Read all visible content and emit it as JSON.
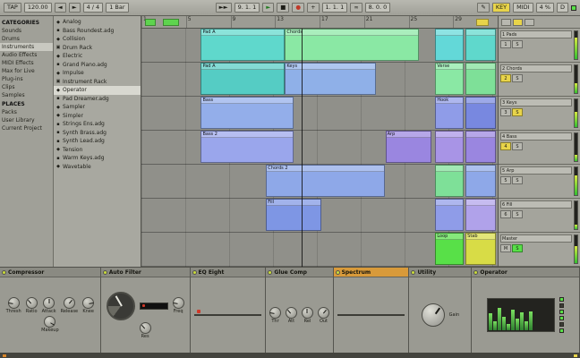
{
  "colors": {
    "accent_yellow": "#e8d44a",
    "accent_green": "#58e048",
    "record_red": "#c03828",
    "meter_green": "#30c030"
  },
  "transport": {
    "tap": "TAP",
    "tempo": "120.00",
    "nudge_down": "◄",
    "nudge_up": "►",
    "signature": "4 / 4",
    "quantize": "1 Bar",
    "follow": "►►",
    "position": "9. 1. 1",
    "play": "►",
    "stop": "■",
    "record": "●",
    "overdub": "+",
    "loop_start": "1. 1. 1",
    "loop": "∞",
    "loop_length": "8. 0. 0",
    "pencil": "✎",
    "key": "KEY",
    "midi": "MIDI",
    "cpu": "4 %",
    "disk": "D"
  },
  "browser": {
    "selected_category": "Instruments",
    "sections": [
      {
        "title": "CATEGORIES",
        "items": [
          "Sounds",
          "Drums",
          "Instruments",
          "Audio Effects",
          "MIDI Effects",
          "Max for Live",
          "Plug-ins",
          "Clips",
          "Samples"
        ]
      },
      {
        "title": "PLACES",
        "items": [
          "Packs",
          "User Library",
          "Current Project"
        ]
      }
    ],
    "selected_index": 8,
    "items": [
      {
        "icon": "◆",
        "label": "Analog"
      },
      {
        "icon": "▪",
        "label": "Bass Roundest.adg"
      },
      {
        "icon": "◆",
        "label": "Collision"
      },
      {
        "icon": "▣",
        "label": "Drum Rack"
      },
      {
        "icon": "◆",
        "label": "Electric"
      },
      {
        "icon": "▪",
        "label": "Grand Piano.adg"
      },
      {
        "icon": "◆",
        "label": "Impulse"
      },
      {
        "icon": "▣",
        "label": "Instrument Rack"
      },
      {
        "icon": "◆",
        "label": "Operator"
      },
      {
        "icon": "▪",
        "label": "Pad Dreamer.adg"
      },
      {
        "icon": "◆",
        "label": "Sampler"
      },
      {
        "icon": "◆",
        "label": "Simpler"
      },
      {
        "icon": "▪",
        "label": "Strings Ens.adg"
      },
      {
        "icon": "▪",
        "label": "Synth Brass.adg"
      },
      {
        "icon": "▪",
        "label": "Synth Lead.adg"
      },
      {
        "icon": "◆",
        "label": "Tension"
      },
      {
        "icon": "▪",
        "label": "Warm Keys.adg"
      },
      {
        "icon": "◆",
        "label": "Wavetable"
      }
    ]
  },
  "arrangement": {
    "ruler": {
      "numbers": [
        "1",
        "5",
        "9",
        "13",
        "17",
        "21",
        "25",
        "29"
      ],
      "markers": [
        {
          "left": "1%",
          "width": "3%",
          "color": "#5ed44e"
        },
        {
          "left": "6%",
          "width": "4.5%",
          "color": "#5ed44e"
        },
        {
          "left": "94%",
          "width": "3.5%",
          "color": "#e8d44a"
        }
      ]
    },
    "tracks": [
      {
        "clips": [
          {
            "label": "Pad A",
            "left": "16.7%",
            "width": "23.5%",
            "color": "#5fd8cc"
          },
          {
            "label": "Chords",
            "left": "40.3%",
            "width": "37.5%",
            "color": "#8ae8a4"
          },
          {
            "label": "",
            "left": "82.5%",
            "width": "8%",
            "color": "#63d8d8"
          },
          {
            "label": "",
            "left": "91%",
            "width": "8.5%",
            "color": "#5fd8cc"
          }
        ]
      },
      {
        "clips": [
          {
            "label": "Pad A",
            "left": "16.7%",
            "width": "23.5%",
            "color": "#55ccc4"
          },
          {
            "label": "Keys",
            "left": "40.3%",
            "width": "25.6%",
            "color": "#8fb0e8"
          },
          {
            "label": "Verse",
            "left": "82.5%",
            "width": "8%",
            "color": "#8ae8a4"
          },
          {
            "label": "",
            "left": "91%",
            "width": "8.5%",
            "color": "#7ee098"
          }
        ]
      },
      {
        "clips": [
          {
            "label": "Bass",
            "left": "16.7%",
            "width": "26%",
            "color": "#93aeea"
          },
          {
            "label": "Hook",
            "left": "82.5%",
            "width": "8%",
            "color": "#8f9ce8"
          },
          {
            "label": "",
            "left": "91%",
            "width": "8.5%",
            "color": "#7888e0"
          }
        ]
      },
      {
        "clips": [
          {
            "label": "Bass 2",
            "left": "16.7%",
            "width": "26%",
            "color": "#9aa6ec"
          },
          {
            "label": "Arp",
            "left": "68.5%",
            "width": "12.8%",
            "color": "#9a86e0"
          },
          {
            "label": "",
            "left": "82.5%",
            "width": "8%",
            "color": "#a894e6"
          },
          {
            "label": "",
            "left": "91%",
            "width": "8.5%",
            "color": "#9a86e0"
          }
        ]
      },
      {
        "clips": [
          {
            "label": "Chords 2",
            "left": "35%",
            "width": "33.3%",
            "color": "#8ea8e8"
          },
          {
            "label": "",
            "left": "82.5%",
            "width": "8%",
            "color": "#7ee098"
          },
          {
            "label": "",
            "left": "91%",
            "width": "8.5%",
            "color": "#8ea8e8"
          }
        ]
      },
      {
        "clips": [
          {
            "label": "Fill",
            "left": "35%",
            "width": "15.4%",
            "color": "#7e96e4"
          },
          {
            "label": "",
            "left": "82.5%",
            "width": "8%",
            "color": "#8f9ce8"
          },
          {
            "label": "",
            "left": "91%",
            "width": "8.5%",
            "color": "#b0a2ea"
          }
        ]
      },
      {
        "clips": [
          {
            "label": "Loop",
            "left": "82.5%",
            "width": "8%",
            "color": "#58e048"
          },
          {
            "label": "Stab",
            "left": "91%",
            "width": "8.5%",
            "color": "#d8dc46"
          }
        ]
      }
    ]
  },
  "mixer": {
    "header_colors": [
      "#b8b8b0",
      "#e8d44a",
      "#b8b8b0"
    ],
    "strips": [
      {
        "label": "1 Pads",
        "slots": [
          "1",
          "S"
        ],
        "slot_colors": [
          "#b8b8b0",
          "#b8b8b0"
        ],
        "meter": 78
      },
      {
        "label": "2 Chords",
        "slots": [
          "2",
          "S"
        ],
        "slot_colors": [
          "#e8d44a",
          "#b8b8b0"
        ],
        "meter": 34
      },
      {
        "label": "3 Keys",
        "slots": [
          "3",
          "S"
        ],
        "slot_colors": [
          "#b8b8b0",
          "#e8d44a"
        ],
        "meter": 55
      },
      {
        "label": "4 Bass",
        "slots": [
          "4",
          "S"
        ],
        "slot_colors": [
          "#e8d44a",
          "#b8b8b0"
        ],
        "meter": 22
      },
      {
        "label": "5 Arp",
        "slots": [
          "5",
          "S"
        ],
        "slot_colors": [
          "#b8b8b0",
          "#b8b8b0"
        ],
        "meter": 70
      },
      {
        "label": "6 Fill",
        "slots": [
          "6",
          "S"
        ],
        "slot_colors": [
          "#b8b8b0",
          "#b8b8b0"
        ],
        "meter": 15
      },
      {
        "label": "Master",
        "slots": [
          "M",
          "S"
        ],
        "slot_colors": [
          "#b8b8b0",
          "#58e048"
        ],
        "meter": 62
      }
    ]
  },
  "devices": {
    "panels": [
      {
        "name": "Compressor",
        "type": "knobs",
        "w": 17.4,
        "title_bg": "#8a8a82",
        "knobs": [
          "Thresh",
          "Ratio",
          "Attack",
          "Release",
          "Knee",
          "Makeup"
        ]
      },
      {
        "name": "Auto Filter",
        "type": "gauge",
        "w": 15.4,
        "title_bg": "#8a8a82",
        "knobs": [
          "Freq",
          "Res"
        ]
      },
      {
        "name": "EQ Eight",
        "type": "display",
        "w": 13.1,
        "title_bg": "#8a8a82",
        "curve": "0,28 10,25 20,18 30,12 38,17 48,21 58,14 68,17 78,10 88,15 100,22",
        "curve_color": "#8fd2ff"
      },
      {
        "name": "Glue Comp",
        "type": "knobs",
        "w": 11.6,
        "title_bg": "#8a8a82",
        "knobs": [
          "Thr",
          "Att",
          "Rel",
          "Out"
        ]
      },
      {
        "name": "Spectrum",
        "type": "spectrum",
        "w": 13.1,
        "title_bg": "#d89a3a",
        "curve": "0,30 8,20 16,25 24,12 32,19 40,8 48,17 56,13 64,21 72,17 80,25 90,23 100,30",
        "curve2": "0,24 20,22 40,18 60,20 80,24 100,26",
        "curve_color": "#52e052",
        "curve2_color": "#e8e8e0"
      },
      {
        "name": "Utility",
        "type": "dial",
        "w": 10.8,
        "title_bg": "#8a8a82",
        "dial_label": "Gain"
      },
      {
        "name": "Operator",
        "type": "bars",
        "w": 18.6,
        "title_bg": "#8a8a82",
        "bars": [
          55,
          30,
          75,
          45,
          22,
          68,
          38,
          58,
          28,
          62
        ],
        "leds": [
          "#58e048",
          "#3a3a34",
          "#58e048",
          "#58e048",
          "#3a3a34",
          "#58e048"
        ]
      }
    ]
  }
}
